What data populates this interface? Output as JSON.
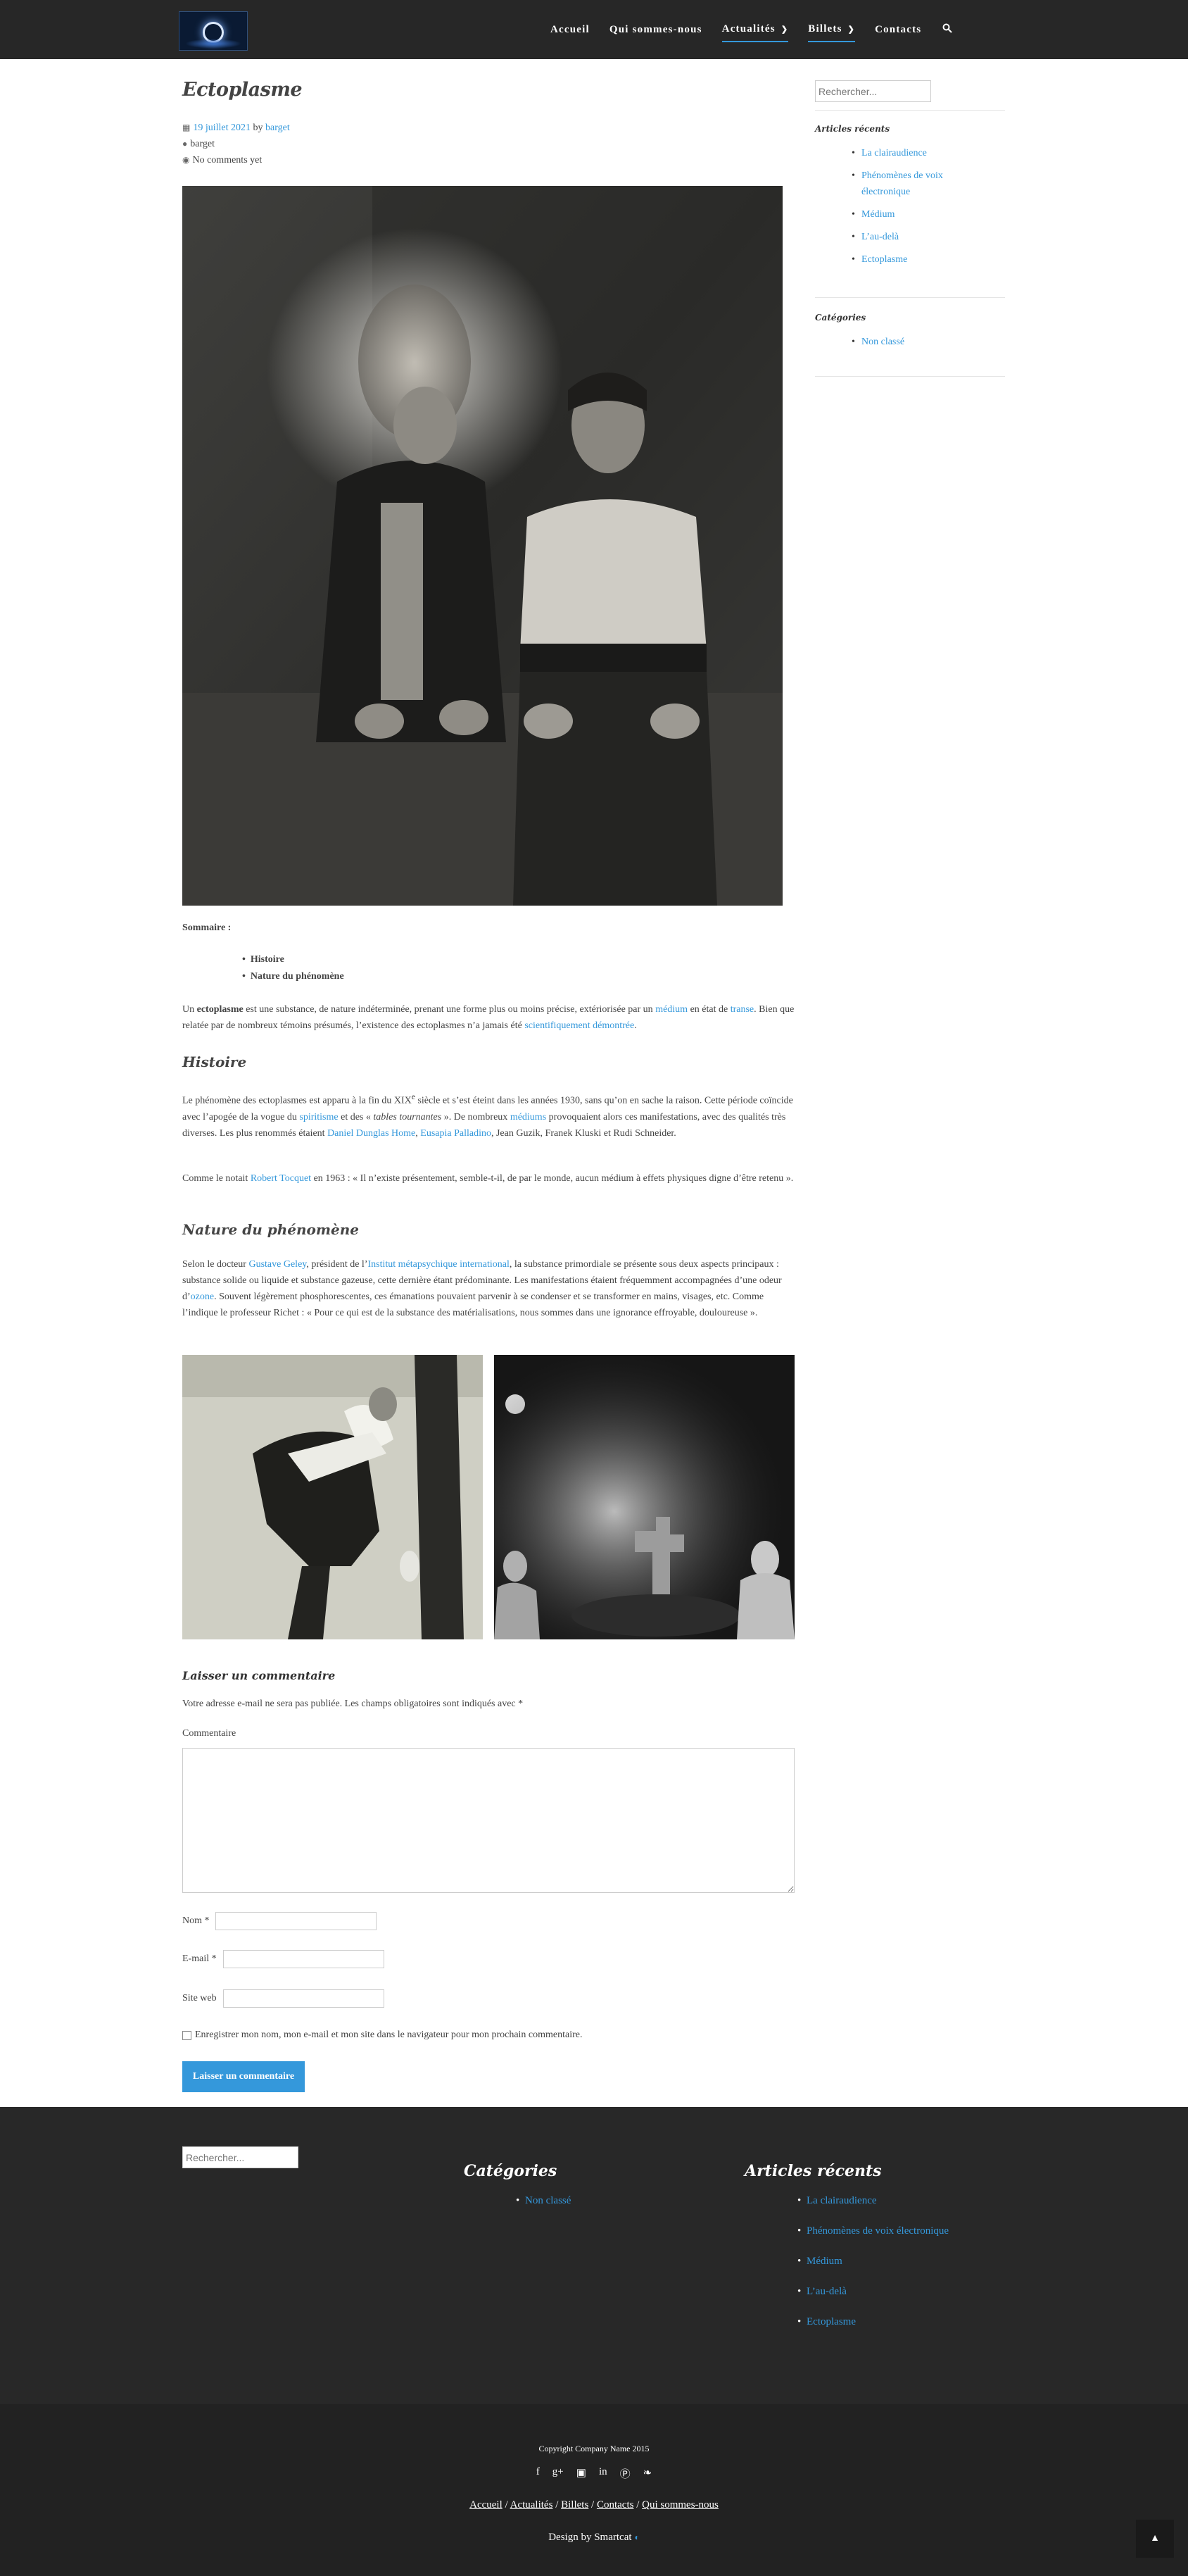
{
  "header": {
    "logo_alt": "Logo",
    "nav": [
      {
        "label": "Accueil"
      },
      {
        "label": "Qui sommes-nous"
      },
      {
        "label": "Actualités"
      },
      {
        "label": "Billets"
      },
      {
        "label": "Contacts"
      }
    ],
    "search_icon": "search-icon"
  },
  "post": {
    "title": "Ectoplasme",
    "date": "19 juillet 2021",
    "by": "by",
    "author": "barget",
    "author_line": "barget",
    "comments": "No comments yet",
    "toc_title": "Sommaire :",
    "toc": [
      "Histoire",
      "Nature du phénomène"
    ],
    "intro": {
      "p1": "Un ",
      "bold": "ectoplasme",
      "p2": " est une substance, de nature indéterminée, prenant une forme plus ou moins précise, extériorisée par un ",
      "link1": "médium",
      "p3": " en état de ",
      "link2": "transe",
      "p4": ". Bien que relatée par de nombreux témoins présumés, l’existence des ectoplasmes n’a jamais été ",
      "link3": "scientifiquement démontrée",
      "p5": "."
    },
    "h_histoire": "Histoire",
    "histoire": {
      "t1": "Le phénomène des ectoplasmes est apparu à la fin du XIX",
      "sup": "e",
      "t2": " siècle et s’est éteint dans les années 1930, sans qu’on en sache la raison. Cette période coïncide avec l’apogée de la vogue du ",
      "link1": "spiritisme",
      "t3": " et des « ",
      "em": "tables tournantes",
      "t4": " ». De nombreux ",
      "link2": "médiums",
      "t5": " provoquaient alors ces manifestations, avec des qualités très diverses. Les plus renommés étaient ",
      "link3": "Daniel Dunglas Home",
      "t6": ", ",
      "link4": "Eusapia Palladino",
      "t7": ", Jean Guzik, Franek Kluski et Rudi Schneider."
    },
    "quote": {
      "t1": "Comme le notait ",
      "link": "Robert Tocquet",
      "t2": " en 1963 : « Il n’existe présentement, semble-t-il, de par le monde, aucun médium à effets physiques digne d’être retenu »."
    },
    "h_nature": "Nature du phénomène",
    "nature": {
      "t1": "Selon le docteur ",
      "link1": "Gustave Geley",
      "t2": ", président de l’",
      "link2": "Institut métapsychique international",
      "t3": ", la substance primordiale se présente sous deux aspects principaux : substance solide ou liquide et substance gazeuse, cette dernière étant prédominante. Les manifestations étaient fréquemment accompagnées d’une odeur d’",
      "link3": "ozone",
      "t4": ". Souvent légèrement phosphorescentes, ces émanations pouvaient parvenir à se condenser et se transformer en mains, visages, etc. Comme l’indique le professeur Richet : « Pour ce qui est de la substance des matérialisations, nous sommes dans une ignorance effroyable, douloureuse »."
    }
  },
  "comment_form": {
    "title": "Laisser un commentaire",
    "notice": "Votre adresse e-mail ne sera pas publiée. Les champs obligatoires sont indiqués avec *",
    "comment_label": "Commentaire",
    "name_label": "Nom *",
    "email_label": "E-mail *",
    "site_label": "Site web",
    "cookie_label": "Enregistrer mon nom, mon e-mail et mon site dans le navigateur pour mon prochain commentaire.",
    "submit": "Laisser un commentaire"
  },
  "sidebar": {
    "search_placeholder": "Rechercher...",
    "recent_title": "Articles récents",
    "recent": [
      "La clairaudience",
      "Phénomènes de voix électronique",
      "Médium",
      "L’au-delà",
      "Ectoplasme"
    ],
    "cat_title": "Catégories",
    "categories": [
      "Non classé"
    ]
  },
  "footer": {
    "search_placeholder": "Rechercher...",
    "cat_title": "Catégories",
    "categories": [
      "Non classé"
    ],
    "recent_title": "Articles récents",
    "recent": [
      "La clairaudience",
      "Phénomènes de voix électronique",
      "Médium",
      "L’au-delà",
      "Ectoplasme"
    ],
    "copyright": "Copyright Company Name 2015",
    "social_icons": [
      "facebook-icon",
      "google-plus-icon",
      "instagram-icon",
      "linkedin-icon",
      "pinterest-icon",
      "twitter-icon"
    ],
    "links": [
      "Accueil",
      "Actualités",
      "Billets",
      "Contacts",
      "Qui sommes-nous"
    ],
    "design": "Design by Smartcat"
  },
  "colors": {
    "accent": "#3498db",
    "header_bg": "#272727",
    "footer_bg": "#282828",
    "footer_bottom_bg": "#222222"
  }
}
